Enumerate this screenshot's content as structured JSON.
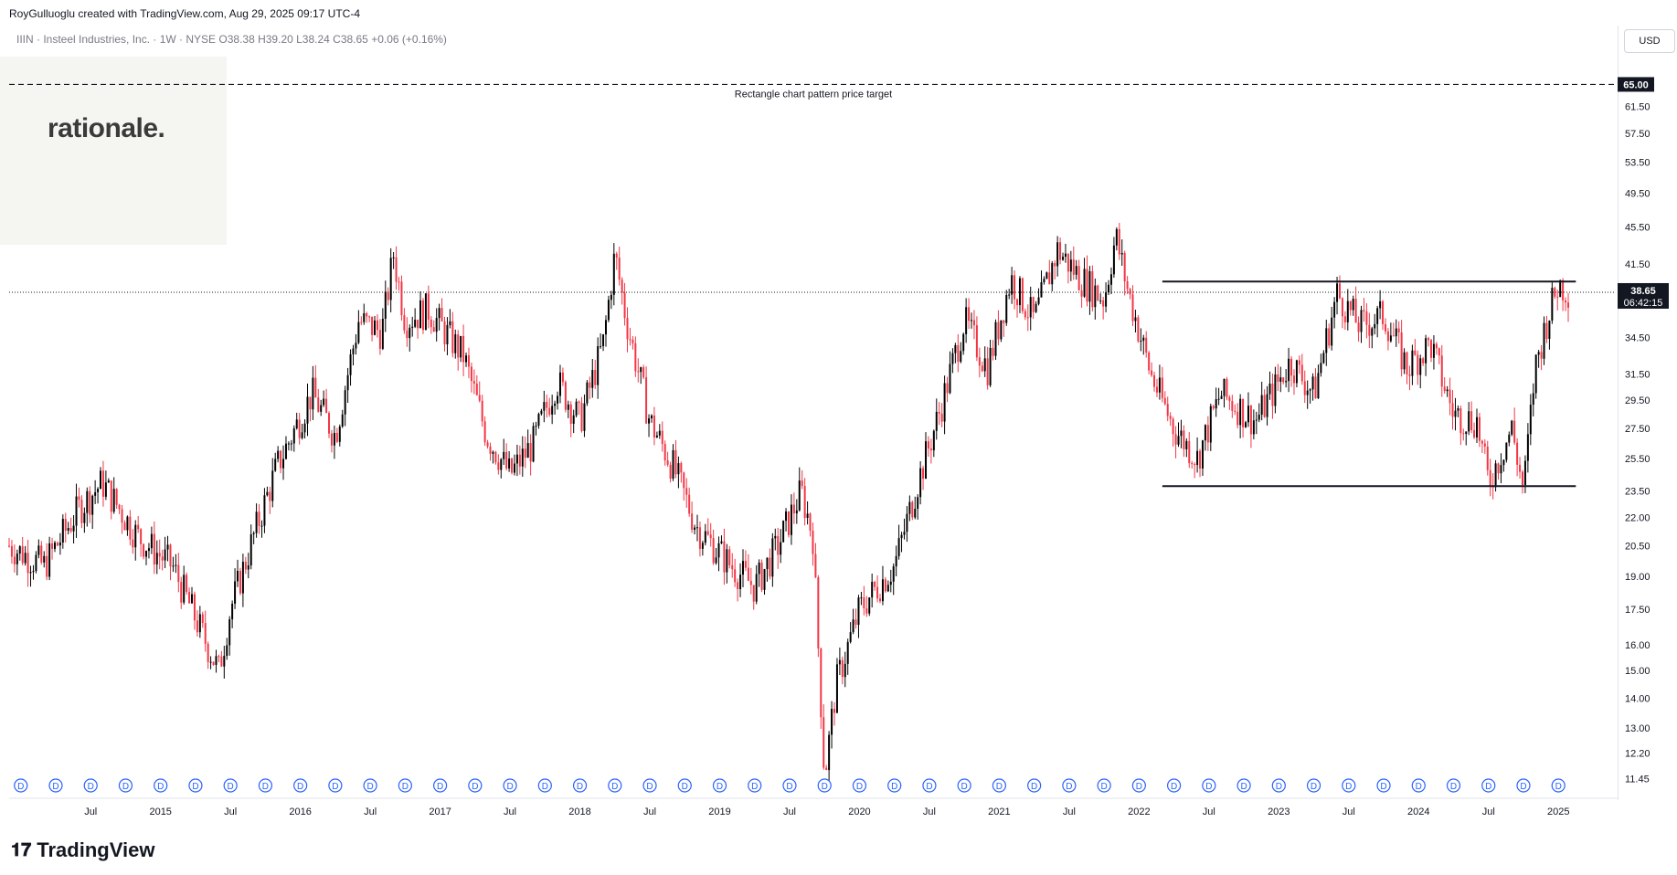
{
  "caption": "RoyGulluoglu created with TradingView.com, Aug 29, 2025 09:17 UTC-4",
  "symbol_line": "IIIN · Insteel Industries, Inc. · 1W · NYSE  O38.38  H39.20  L38.24  C38.65  +0.06 (+0.16%)",
  "logo_text": "rationale.",
  "currency": "USD",
  "watermark": "TradingView",
  "colors": {
    "up": "#000000",
    "down": "#f23645",
    "line": "#131722"
  },
  "chart_data": {
    "type": "candlestick",
    "y_scale": "log",
    "y_ticks": [
      "11.45",
      "12.20",
      "13.00",
      "14.00",
      "15.00",
      "16.00",
      "17.50",
      "19.00",
      "20.50",
      "22.00",
      "23.50",
      "25.50",
      "27.50",
      "29.50",
      "31.50",
      "34.50",
      "38.65",
      "41.50",
      "45.50",
      "49.50",
      "53.50",
      "57.50",
      "61.50",
      "65.00"
    ],
    "x_ticks": [
      "Jul",
      "2015",
      "Jul",
      "2016",
      "Jul",
      "2017",
      "Jul",
      "2018",
      "Jul",
      "2019",
      "Jul",
      "2020",
      "Jul",
      "2021",
      "Jul",
      "2022",
      "Jul",
      "2023",
      "Jul",
      "2024",
      "Jul",
      "2025",
      "Jul"
    ],
    "last_price": "38.65",
    "countdown": "06:42:15",
    "target_price": "65.00",
    "target_label": "Rectangle chart pattern price target",
    "rectangle": {
      "top": 39.7,
      "bottom": 23.8
    },
    "price_path": [
      [
        "2014-06",
        20.5
      ],
      [
        "2014-09",
        19.5
      ],
      [
        "2014-12",
        22.5
      ],
      [
        "2015-02",
        24.0
      ],
      [
        "2015-05",
        21.0
      ],
      [
        "2015-08",
        19.5
      ],
      [
        "2015-11",
        16.0
      ],
      [
        "2015-12",
        15.0
      ],
      [
        "2016-01",
        17.5
      ],
      [
        "2016-03",
        21.0
      ],
      [
        "2016-05",
        25.0
      ],
      [
        "2016-08",
        30.0
      ],
      [
        "2016-10",
        27.0
      ],
      [
        "2016-12",
        36.0
      ],
      [
        "2017-02",
        35.0
      ],
      [
        "2017-03",
        42.5
      ],
      [
        "2017-04",
        36.0
      ],
      [
        "2017-06",
        37.0
      ],
      [
        "2017-09",
        33.0
      ],
      [
        "2017-11",
        27.0
      ],
      [
        "2018-01",
        24.5
      ],
      [
        "2018-03",
        26.5
      ],
      [
        "2018-05",
        31.0
      ],
      [
        "2018-07",
        28.0
      ],
      [
        "2018-09",
        34.0
      ],
      [
        "2018-10",
        42.5
      ],
      [
        "2018-11",
        36.0
      ],
      [
        "2019-01",
        28.0
      ],
      [
        "2019-03",
        25.0
      ],
      [
        "2019-05",
        21.5
      ],
      [
        "2019-08",
        19.5
      ],
      [
        "2019-10",
        18.5
      ],
      [
        "2019-12",
        20.5
      ],
      [
        "2020-02",
        23.5
      ],
      [
        "2020-03",
        21.0
      ],
      [
        "2020-04",
        11.5
      ],
      [
        "2020-05",
        14.5
      ],
      [
        "2020-07",
        17.5
      ],
      [
        "2020-10",
        19.5
      ],
      [
        "2020-12",
        24.0
      ],
      [
        "2021-02",
        29.0
      ],
      [
        "2021-04",
        36.0
      ],
      [
        "2021-06",
        32.0
      ],
      [
        "2021-08",
        40.0
      ],
      [
        "2021-10",
        36.0
      ],
      [
        "2021-12",
        43.0
      ],
      [
        "2022-02",
        40.0
      ],
      [
        "2022-04",
        38.0
      ],
      [
        "2022-05",
        44.5
      ],
      [
        "2022-06",
        39.0
      ],
      [
        "2022-08",
        31.5
      ],
      [
        "2022-10",
        27.5
      ],
      [
        "2022-12",
        25.5
      ],
      [
        "2023-02",
        30.0
      ],
      [
        "2023-05",
        28.0
      ],
      [
        "2023-08",
        32.5
      ],
      [
        "2023-10",
        30.0
      ],
      [
        "2023-12",
        38.5
      ],
      [
        "2024-02",
        35.5
      ],
      [
        "2024-04",
        36.5
      ],
      [
        "2024-06",
        32.0
      ],
      [
        "2024-08",
        34.0
      ],
      [
        "2024-10",
        28.5
      ],
      [
        "2024-12",
        28.0
      ],
      [
        "2025-01",
        24.0
      ],
      [
        "2025-03",
        27.5
      ],
      [
        "2025-04",
        23.5
      ],
      [
        "2025-05",
        32.0
      ],
      [
        "2025-06",
        36.0
      ],
      [
        "2025-07",
        39.5
      ],
      [
        "2025-08",
        38.65
      ]
    ]
  }
}
